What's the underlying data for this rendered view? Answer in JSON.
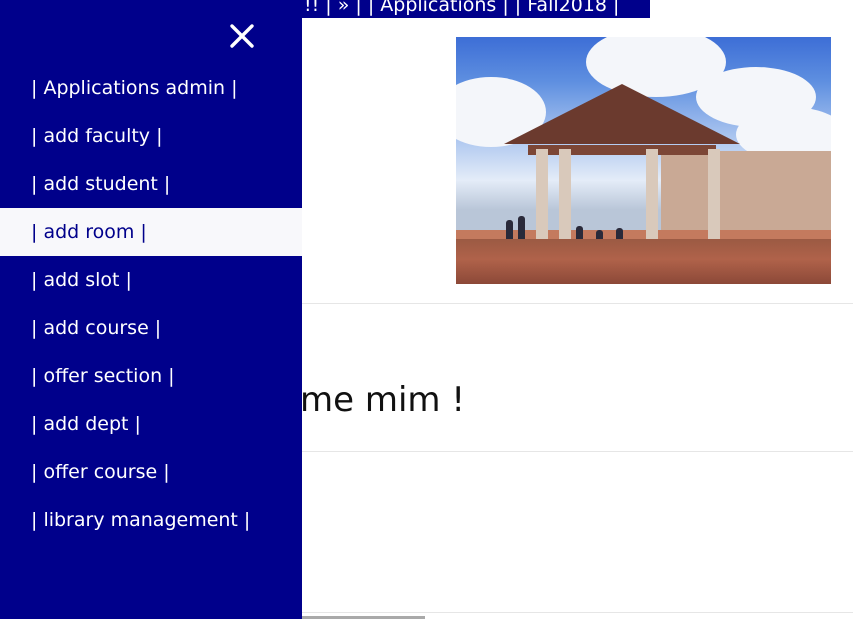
{
  "topbar": {
    "text": "!! | » | | Applications | | Fall2018 |"
  },
  "welcome": {
    "text": "me mim !"
  },
  "sidenav": {
    "close_glyph": "×",
    "items": [
      {
        "label": "| Applications admin |"
      },
      {
        "label": "| add faculty |"
      },
      {
        "label": "| add student |"
      },
      {
        "label": "| add room |",
        "active": true
      },
      {
        "label": "| add slot |"
      },
      {
        "label": "| add course |"
      },
      {
        "label": "| offer section |"
      },
      {
        "label": "| add dept |"
      },
      {
        "label": "| offer course |"
      },
      {
        "label": "| library management |"
      }
    ]
  },
  "colors": {
    "nav_bg": "#00008b",
    "active_bg": "#f8f8fb",
    "text_on_nav": "#ffffff"
  },
  "photo": {
    "subject": "campus-pavilion-photo"
  }
}
